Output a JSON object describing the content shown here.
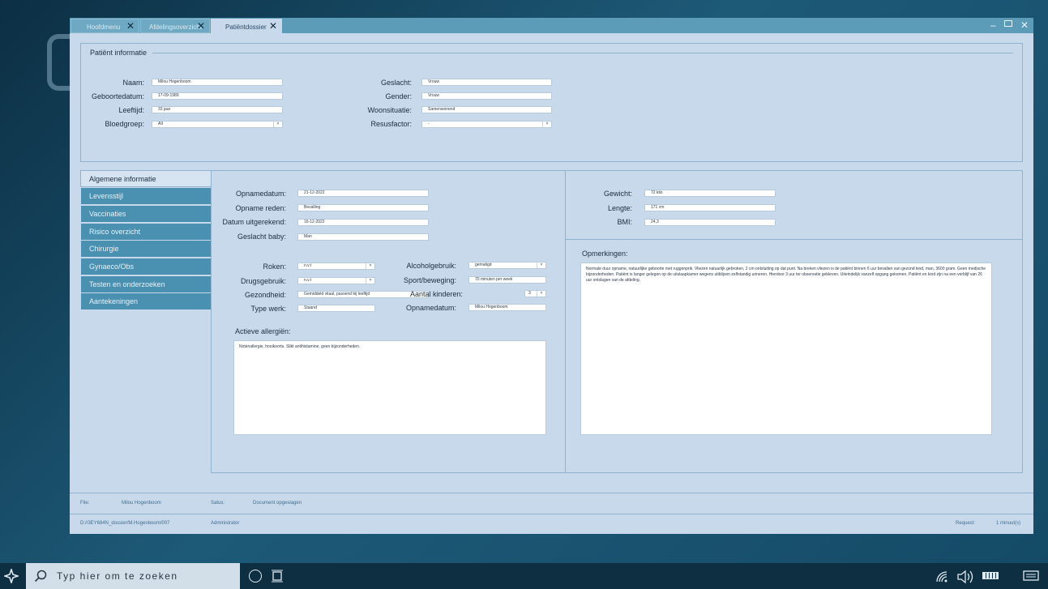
{
  "tabs": [
    {
      "label": "Hoofdmenu",
      "active": false
    },
    {
      "label": "Afdelingsoverzicht",
      "active": false
    },
    {
      "label": "Patiëntdossier",
      "active": true
    }
  ],
  "patient_info": {
    "title": "Patiënt informatie",
    "fields": [
      {
        "label": "Naam:",
        "value": "Milou Hogenboom"
      },
      {
        "label": "Geboortedatum:",
        "value": "17-09-1989"
      },
      {
        "label": "Leeftijd:",
        "value": "33 jaar"
      },
      {
        "label": "Bloedgroep:",
        "value": "A9"
      },
      {
        "label": "Geslacht:",
        "value": "Vrouw"
      },
      {
        "label": "Gender:",
        "value": "Vrouw"
      },
      {
        "label": "Woonsituatie:",
        "value": "Samenwonend"
      },
      {
        "label": "Resusfactor:",
        "value": "-"
      }
    ]
  },
  "sidebar": {
    "title": "Algemene informatie",
    "items": [
      "Levensstijl",
      "Vaccinaties",
      "Risico overzicht",
      "Chirurgie",
      "Gynaeco/Obs",
      "Testen en onderzoeken",
      "Aantekeningen"
    ]
  },
  "admission": [
    {
      "label": "Opnamedatum:",
      "value": "21-12-2022"
    },
    {
      "label": "Opname reden:",
      "value": "Bevalling"
    },
    {
      "label": "Datum uitgerekend:",
      "value": "16-12-2022"
    },
    {
      "label": "Geslacht baby:",
      "value": "Man"
    }
  ],
  "lifestyle": [
    {
      "label": "Roken:",
      "value": "n.v.t"
    },
    {
      "label": "Drugsgebruik:",
      "value": "n.v.t"
    },
    {
      "label": "Gezondheid:",
      "value": "Gemiddeld vitaal, passend bij leeftijd"
    },
    {
      "label": "Type werk:",
      "value": "Staand"
    },
    {
      "label": "Alcoholgebruik:",
      "value": "gematigd"
    },
    {
      "label": "Sport/beweging:",
      "value": "70 minuten per week"
    },
    {
      "label": "Aantal kinderen:",
      "value": "3"
    },
    {
      "label": "Opnamedatum:",
      "value": "Milou Hogenboom"
    }
  ],
  "allergies": {
    "title": "Actieve allergiën:",
    "text": "Notenallergie, hooikoorts. Slikt antihistamine, geen bijzonderheden."
  },
  "measurements": [
    {
      "label": "Gewicht:",
      "value": "72 kilo"
    },
    {
      "label": "Lengte:",
      "value": "171 cm"
    },
    {
      "label": "BMI:",
      "value": "24,3"
    }
  ],
  "remarks": {
    "title": "Opmerkingen:",
    "text": "Normale duur opname, natuurlijke geboorte met ruggenprik. Vliezen natuurlijk gebroken, 2 cm ontsluiting op dat punt. Na breken vliezen is de patiënt binnen 6 uur bevallen van gezond kind, man, 3600 gram. Geen medische bijzonderheden. Patiënt is langer gelegen op de uitslaapkamer wegens uitblijven zelfstandig urineren. Hierdoor 3 uur ter observatie gebleven. Uiteindelijk vanzelf opgang gekomen. Patiënt en kind zijn na een verblijf van 26 uur ontslagen van de afdeling."
  },
  "status_bar": {
    "file_label": "File:",
    "file_value": "Milou Hogenboom",
    "status_label": "Satus:",
    "status_value": "Document opgeslagen",
    "path": "D://3EY684N_dossier/M.Hogenboom/007",
    "user": "Administrator",
    "request_label": "Request:",
    "request_value": "1 minuut(s)"
  },
  "taskbar": {
    "search_placeholder": "Typ hier om te zoeken"
  },
  "colors": {
    "titlebar": "#5d9cb8",
    "window_bg": "#c9d9ec",
    "menu_item": "#4a90b0",
    "taskbar": "#0e2e42"
  }
}
